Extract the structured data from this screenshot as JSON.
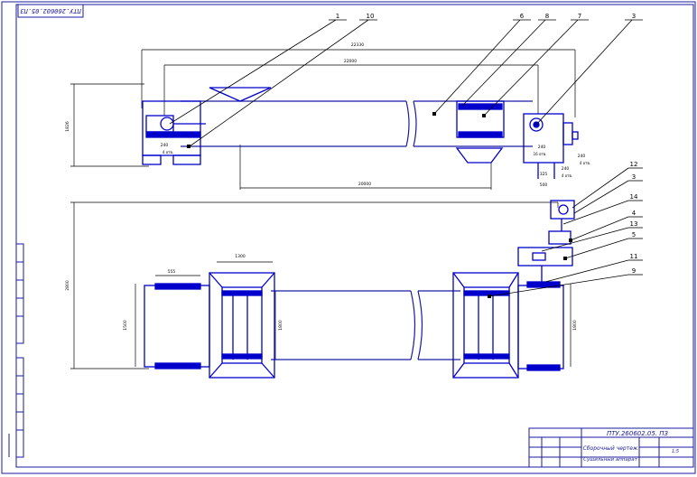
{
  "document": {
    "code_rotated": "ПТУ.260602.05.ПЗ",
    "title_block": {
      "code": "ПТУ.260602.05. ПЗ",
      "title_line1": "Сборочный чертеж",
      "title_line2": "Сушильный аппарат",
      "sheet": "1:5"
    }
  },
  "colors": {
    "outline": "#1a1aa0",
    "part": "#0000cc",
    "dim": "#000000"
  },
  "callouts": [
    "1",
    "10",
    "6",
    "8",
    "7",
    "3",
    "12",
    "3",
    "14",
    "4",
    "13",
    "5",
    "11",
    "9"
  ],
  "dimensions": {
    "top": {
      "overall_22330": "22330",
      "span_22000": "22000",
      "lower_20000": "20000",
      "height_1826": "1826",
      "d240_left": "240",
      "d4otv_left": "4 отв.",
      "d240_right_a": "240",
      "d240_right_b": "240",
      "d16otv": "16 отв.",
      "d4otv_right": "4 отв.",
      "d325": "325",
      "d500": "500"
    },
    "bottom": {
      "d555": "555",
      "d1300": "1300",
      "d1500": "1500",
      "d1800_mid": "1800",
      "d1800_right": "1800",
      "d2800": "2800"
    }
  }
}
